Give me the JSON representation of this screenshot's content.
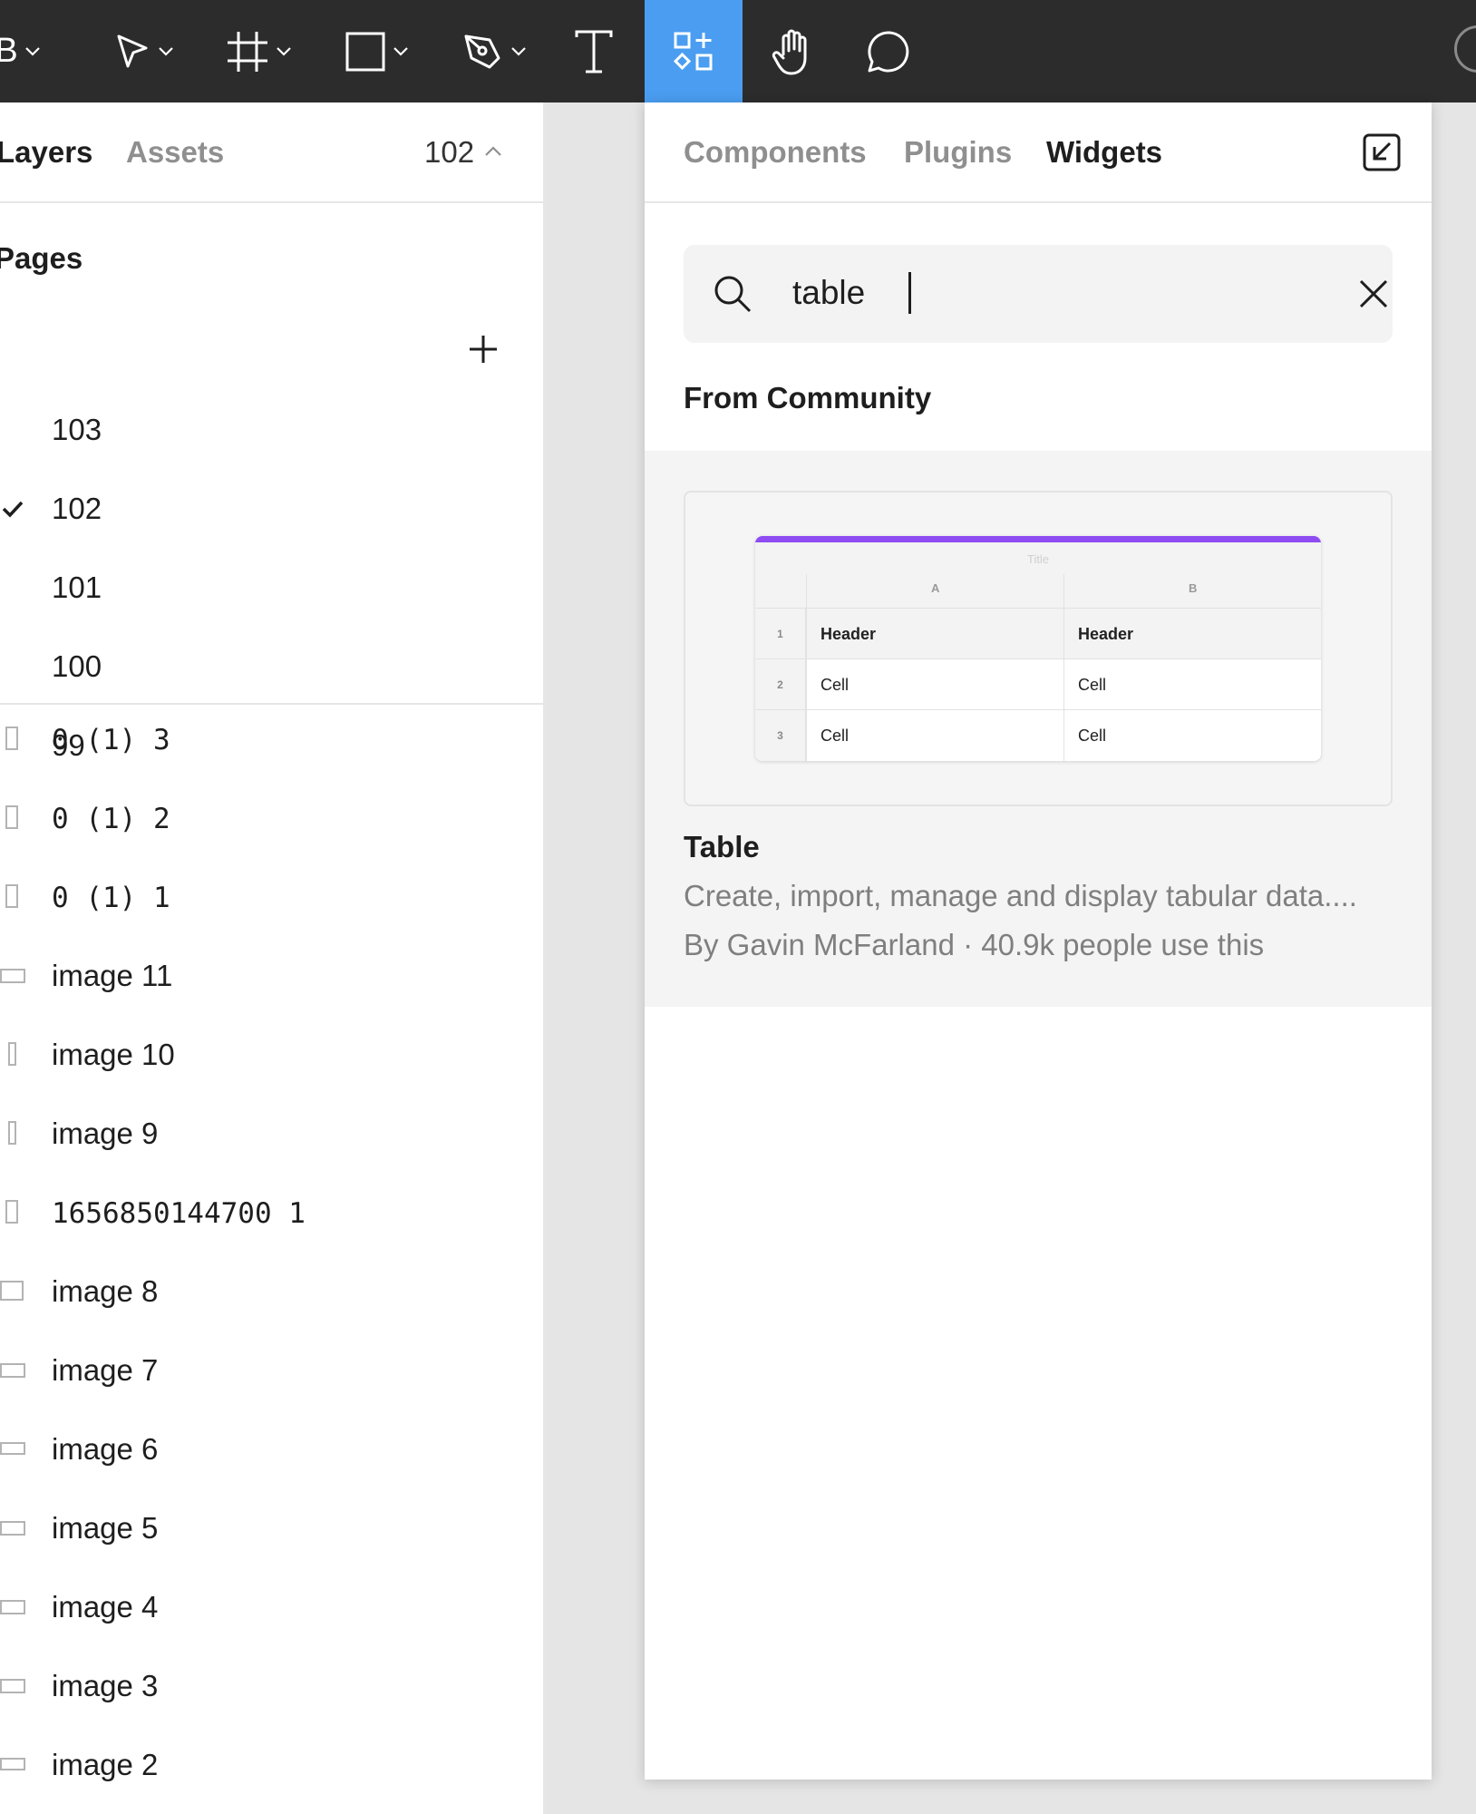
{
  "colors": {
    "toolbar_bg": "#2c2c2c",
    "active_tool": "#4a9df1",
    "widget_accent": "#8e4cf2"
  },
  "toolbar": {
    "menu_glyph": "B",
    "tools": [
      {
        "icon": "move-icon",
        "has_dropdown": true
      },
      {
        "icon": "frame-icon",
        "has_dropdown": true
      },
      {
        "icon": "rectangle-icon",
        "has_dropdown": true
      },
      {
        "icon": "pen-icon",
        "has_dropdown": true
      },
      {
        "icon": "text-icon",
        "has_dropdown": false
      },
      {
        "icon": "resources-icon",
        "active": true
      },
      {
        "icon": "hand-icon",
        "has_dropdown": false
      },
      {
        "icon": "comment-icon",
        "has_dropdown": false
      }
    ]
  },
  "left_panel": {
    "tabs": {
      "layers": "Layers",
      "assets": "Assets"
    },
    "current_page": "102",
    "pages_title": "Pages",
    "pages": [
      "103",
      "102",
      "101",
      "100",
      "99"
    ],
    "selected_page": "102",
    "layers": [
      {
        "label": "0 (1) 3",
        "icon": "portrait-frame-icon"
      },
      {
        "label": "0 (1) 2",
        "icon": "portrait-frame-icon"
      },
      {
        "label": "0 (1) 1",
        "icon": "portrait-frame-icon"
      },
      {
        "label": "image 11",
        "icon": "landscape-image-icon"
      },
      {
        "label": "image 10",
        "icon": "narrow-image-icon"
      },
      {
        "label": "image 9",
        "icon": "narrow-image-icon"
      },
      {
        "label": "1656850144700 1",
        "icon": "portrait-frame-icon"
      },
      {
        "label": "image 8",
        "icon": "square-image-icon"
      },
      {
        "label": "image 7",
        "icon": "landscape-image-icon"
      },
      {
        "label": "image 6",
        "icon": "landscape-image-icon"
      },
      {
        "label": "image 5",
        "icon": "landscape-image-icon"
      },
      {
        "label": "image 4",
        "icon": "landscape-image-icon"
      },
      {
        "label": "image 3",
        "icon": "landscape-image-icon"
      },
      {
        "label": "image 2",
        "icon": "landscape-image-icon"
      }
    ]
  },
  "resources_panel": {
    "tabs": [
      "Components",
      "Plugins",
      "Widgets"
    ],
    "active_tab": "Widgets",
    "search": {
      "value": "table",
      "placeholder": ""
    },
    "section_title": "From Community",
    "result": {
      "title": "Table",
      "description": "Create, import, manage and display tabular data....",
      "meta": "By Gavin McFarland · 40.9k people use this",
      "preview": {
        "title": "Title",
        "columns": [
          "A",
          "B"
        ],
        "rows": [
          {
            "num": "1",
            "cells": [
              "Header",
              "Header"
            ]
          },
          {
            "num": "2",
            "cells": [
              "Cell",
              "Cell"
            ]
          },
          {
            "num": "3",
            "cells": [
              "Cell",
              "Cell"
            ]
          }
        ]
      }
    }
  }
}
